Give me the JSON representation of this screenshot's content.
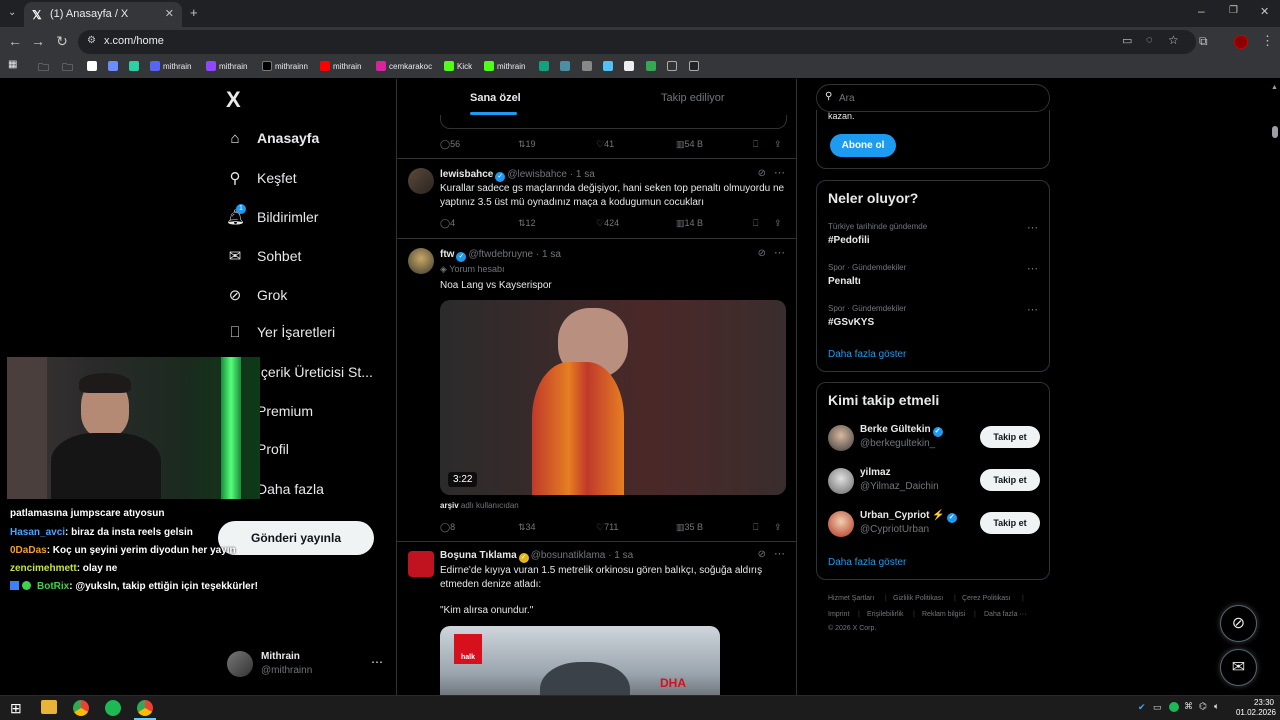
{
  "browser": {
    "tab_title": "(1) Anasayfa / X",
    "url": "x.com/home",
    "bookmarks": [
      "mithrain",
      "mithrain",
      "mithrainn",
      "mithrain",
      "cemkarakoc",
      "Kick",
      "mithrain"
    ]
  },
  "sidebar": {
    "logo": "X",
    "items": [
      {
        "label": "Anasayfa",
        "icon": "home-icon"
      },
      {
        "label": "Keşfet",
        "icon": "search-icon"
      },
      {
        "label": "Bildirimler",
        "icon": "bell-icon"
      },
      {
        "label": "Sohbet",
        "icon": "mail-icon"
      },
      {
        "label": "Grok",
        "icon": "grok-icon"
      },
      {
        "label": "Yer İşaretleri",
        "icon": "bookmark-icon"
      },
      {
        "label": "İçerik Üreticisi St...",
        "icon": "creator-icon"
      },
      {
        "label": "Premium",
        "icon": "premium-icon"
      },
      {
        "label": "Profil",
        "icon": "profile-icon"
      },
      {
        "label": "Daha fazla",
        "icon": "more-icon"
      }
    ],
    "notification_count": "1",
    "post_button": "Gönderi yayınla",
    "account": {
      "name": "Mithrain",
      "handle": "@mithrainn"
    }
  },
  "chat": [
    {
      "user": "",
      "text": "patlamasına jumpscare atıyosun"
    },
    {
      "user": "Hasan_avci",
      "text": ": biraz da insta reels gelsin",
      "color": "#4aa3ff"
    },
    {
      "user": "0DaDas",
      "text": ": Koç un şeyini yerim diyodun her yayın",
      "color": "#f0a030"
    },
    {
      "user": "zencimehmett",
      "text": ": olay ne",
      "color": "#c7e24a"
    },
    {
      "user": "BotRix",
      "text": ": @yuksln, takip ettiğin için teşekkürler!",
      "color": "#3fd14a"
    }
  ],
  "feed": {
    "tabs": [
      "Sana özel",
      "Takip ediliyor"
    ],
    "first_actions": {
      "replies": "56",
      "reposts": "19",
      "likes": "41",
      "views": "54 B"
    },
    "posts": [
      {
        "name": "lewisbahce",
        "handle": "@lewisbahce",
        "time": "1 sa",
        "text": "Kurallar sadece gs maçlarında değişiyor, hani seken top penaltı olmuyordu ne yaptınız 3.5 üst mü oynadınız maça a kodugumun cocukları",
        "replies": "4",
        "reposts": "12",
        "likes": "424",
        "views": "14 B"
      },
      {
        "name": "ftw",
        "handle": "@ftwdebruyne",
        "time": "1 sa",
        "label": "Yorum hesabı",
        "text": "Noa Lang vs Kayserispor",
        "video_duration": "3:22",
        "caption_user": "arşiv",
        "caption_text": "adlı kullanıcıdan",
        "replies": "8",
        "reposts": "34",
        "likes": "711",
        "views": "35 B"
      },
      {
        "name": "Boşuna Tıklama",
        "handle": "@bosunatiklama",
        "time": "1 sa",
        "text": "Edirne'de kıyıya vuran 1.5 metrelik orkinosu gören balıkçı, soğuğa aldırış etmeden denize atladı:",
        "quote": "\"Kim alırsa onundur.\"",
        "media_logo_1": "halk",
        "media_logo_2": "DHA"
      }
    ]
  },
  "right": {
    "search_placeholder": "Ara",
    "premium_partial": "kazan.",
    "subscribe": "Abone ol",
    "trends_title": "Neler oluyor?",
    "trends": [
      {
        "context": "Türkiye tarihinde gündemde",
        "name": "#Pedofili"
      },
      {
        "context": "Spor · Gündemdekiler",
        "name": "Penaltı"
      },
      {
        "context": "Spor · Gündemdekiler",
        "name": "#GSvKYS"
      }
    ],
    "show_more": "Daha fazla göster",
    "who_to_follow_title": "Kimi takip etmeli",
    "who_to_follow": [
      {
        "name": "Berke Gültekin",
        "handle": "@berkegultekin_"
      },
      {
        "name": "yilmaz",
        "handle": "@Yilmaz_Daichin"
      },
      {
        "name": "Urban_Cypriot ⚡",
        "handle": "@CypriotUrban"
      }
    ],
    "follow": "Takip et",
    "footer": [
      "Hizmet Şartları",
      "Gizlilik Politikası",
      "Çerez Politikası",
      "Imprint",
      "Erişilebilirlik",
      "Reklam bilgisi",
      "Daha fazla ···",
      "© 2026 X Corp."
    ]
  },
  "taskbar": {
    "time": "23:30",
    "date": "01.02.2026"
  }
}
